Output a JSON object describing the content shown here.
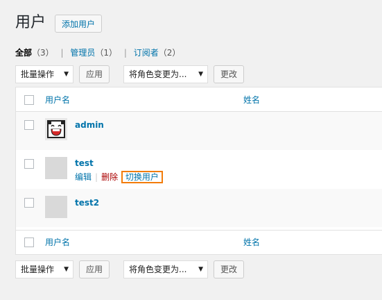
{
  "header": {
    "title": "用户",
    "add_button": "添加用户"
  },
  "views": [
    {
      "label": "全部",
      "count": "（3）",
      "current": true
    },
    {
      "label": "管理员",
      "count": "（1）",
      "current": false
    },
    {
      "label": "订阅者",
      "count": "（2）",
      "current": false
    }
  ],
  "view_sep": "|",
  "toolbar": {
    "bulk_select": "批量操作",
    "apply": "应用",
    "role_select": "将角色变更为...",
    "change": "更改",
    "arrow": "▼"
  },
  "table": {
    "col_username": "用户名",
    "col_name": "姓名",
    "rows": [
      {
        "username": "admin"
      },
      {
        "username": "test",
        "actions": {
          "edit": "编辑",
          "delete": "删除",
          "switch": "切换用户",
          "sep": "|"
        }
      },
      {
        "username": "test2"
      }
    ]
  },
  "colors": {
    "link": "#0073aa",
    "delete": "#aa0000",
    "highlight": "#f27c0a",
    "background": "#f1f1f1"
  }
}
